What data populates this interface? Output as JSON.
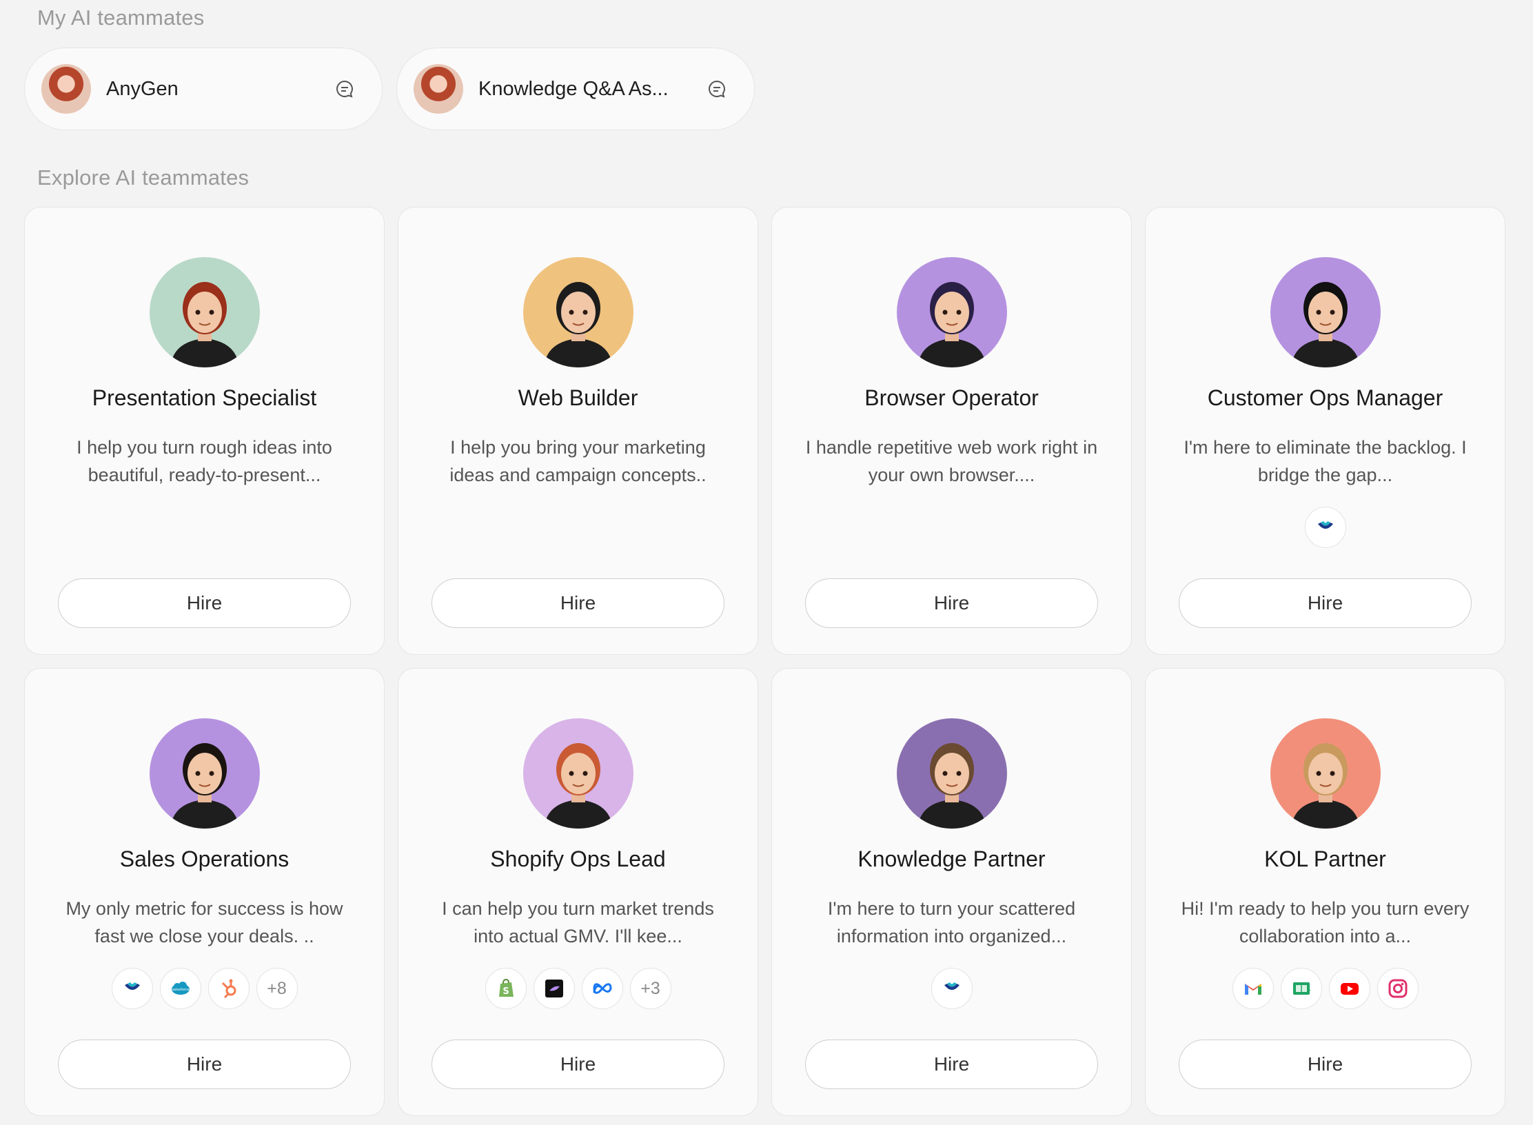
{
  "my_section": {
    "label": "My AI teammates",
    "items": [
      {
        "name": "AnyGen"
      },
      {
        "name": "Knowledge Q&A As..."
      }
    ]
  },
  "explore_section": {
    "label": "Explore AI teammates",
    "hire_label": "Hire",
    "cards": [
      {
        "title": "Presentation Specialist",
        "desc": "I help you turn rough ideas into beautiful, ready-to-present...",
        "avatar_bg": "#b9d9c8",
        "hair": "#9a2f1a",
        "tools": []
      },
      {
        "title": "Web Builder",
        "desc": "I help you bring your marketing ideas and campaign concepts..",
        "avatar_bg": "#efc27e",
        "hair": "#1c1c1c",
        "tools": []
      },
      {
        "title": "Browser Operator",
        "desc": "I handle repetitive web work right in your own browser....",
        "avatar_bg": "#b592e0",
        "hair": "#2a1f45",
        "tools": []
      },
      {
        "title": "Customer Ops Manager",
        "desc": "I'm here to eliminate the backlog. I bridge the gap...",
        "avatar_bg": "#b592e0",
        "hair": "#111111",
        "tools": [
          "intercom-icon"
        ]
      },
      {
        "title": "Sales Operations",
        "desc": "My only metric for success is how fast we close your deals. ..",
        "avatar_bg": "#b592e0",
        "hair": "#1a1410",
        "tools": [
          "intercom-icon",
          "salesforce-icon",
          "hubspot-icon",
          "+8"
        ]
      },
      {
        "title": "Shopify Ops Lead",
        "desc": "I can help you turn market trends into actual GMV. I'll kee...",
        "avatar_bg": "#d8b4e8",
        "hair": "#c95a34",
        "tools": [
          "shopify-icon",
          "app-icon",
          "meta-icon",
          "+3"
        ]
      },
      {
        "title": "Knowledge Partner",
        "desc": "I'm here to turn your scattered information into organized...",
        "avatar_bg": "#8a6fb0",
        "hair": "#6a4a30",
        "tools": [
          "intercom-icon"
        ]
      },
      {
        "title": "KOL Partner",
        "desc": "Hi! I'm ready to help you turn every collaboration into a...",
        "avatar_bg": "#f28f7a",
        "hair": "#c99a5e",
        "tools": [
          "gmail-icon",
          "sheet-icon",
          "youtube-icon",
          "instagram-icon"
        ]
      }
    ]
  }
}
